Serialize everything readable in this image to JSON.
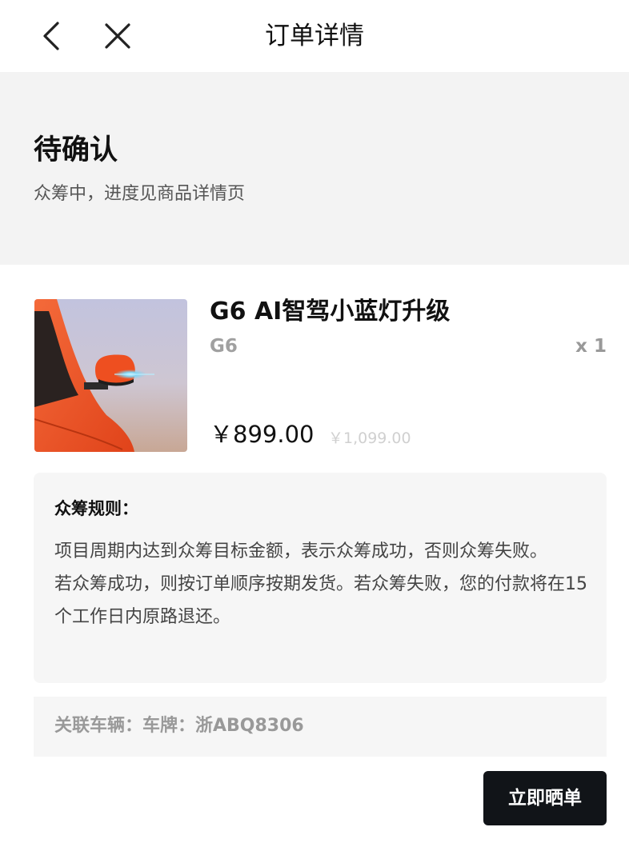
{
  "header": {
    "title": "订单详情",
    "back_icon": "chevron-left-icon",
    "close_icon": "close-icon"
  },
  "status": {
    "title": "待确认",
    "subtitle": "众筹中，进度见商品详情页"
  },
  "product": {
    "name": "G6 AI智驾小蓝灯升级",
    "variant": "G6",
    "quantity": "x 1",
    "price": "￥899.00",
    "original_price": "￥1,099.00",
    "image_colors": {
      "body": "#f0521f",
      "sky": "#c4c3dc",
      "light": "#7fd6f5"
    }
  },
  "rules": {
    "title": "众筹规则：",
    "line1": "项目周期内达到众筹目标金额，表示众筹成功，否则众筹失败。",
    "line2": "若众筹成功，则按订单顺序按期发货。若众筹失败，您的付款将在15个工作日内原路退还。"
  },
  "vehicle": {
    "text": "关联车辆：车牌：浙ABQ8306"
  },
  "actions": {
    "share_label": "立即晒单"
  }
}
